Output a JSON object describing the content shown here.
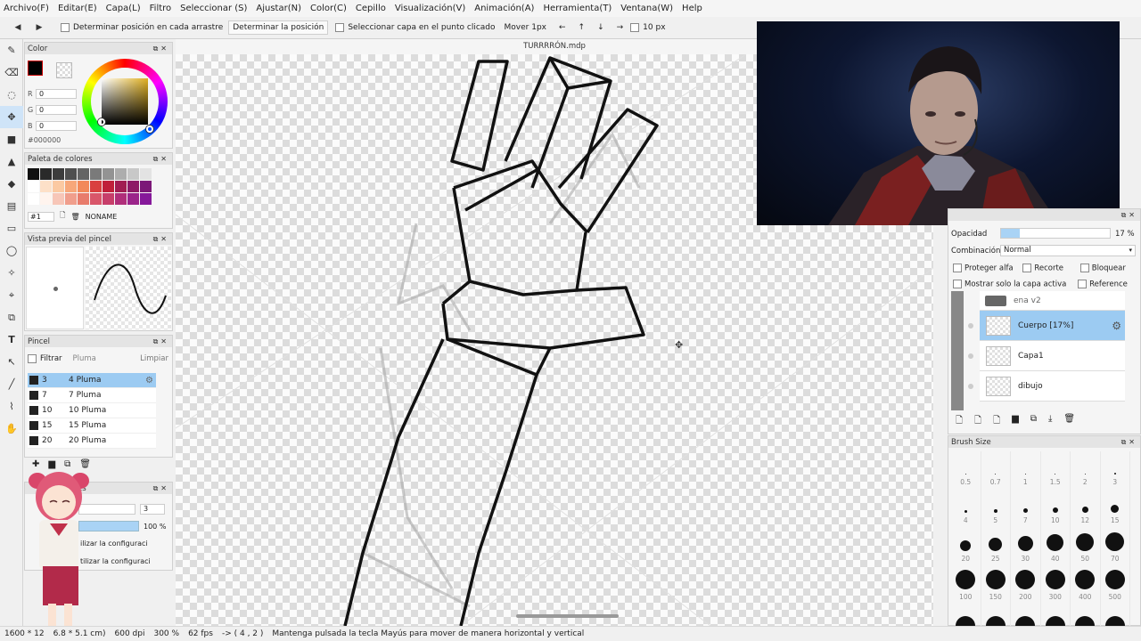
{
  "menu": [
    "Archivo(F)",
    "Editar(E)",
    "Capa(L)",
    "Filtro",
    "Seleccionar (S)",
    "Ajustar(N)",
    "Color(C)",
    "Cepillo",
    "Visualización(V)",
    "Animación(A)",
    "Herramienta(T)",
    "Ventana(W)",
    "Help"
  ],
  "toolbar": {
    "check1": "Determinar posición en cada arrastre",
    "button1": "Determinar la posición",
    "check2": "Seleccionar capa en el punto clicado",
    "move_label": "Mover 1px",
    "px_value": "10 px"
  },
  "color_panel": {
    "title": "Color",
    "r_label": "R",
    "r_value": "0",
    "g_label": "G",
    "g_value": "0",
    "b_label": "B",
    "b_value": "0",
    "hex": "#000000"
  },
  "palette_panel": {
    "title": "Paleta de colores",
    "index": "#1",
    "name": "NONAME",
    "colors": [
      "#111111",
      "#2a2a2a",
      "#3c3c3c",
      "#4f4f4f",
      "#646464",
      "#7a7a7a",
      "#939393",
      "#adadad",
      "#c8c8c8",
      "#e3e3e3",
      "#ffffff",
      "#fde0c8",
      "#fbc9a2",
      "#f7a77a",
      "#f2895a",
      "#d94040",
      "#c0203a",
      "#a11d52",
      "#8e1a66",
      "#7c1878",
      "#ffffff",
      "#fff4ee",
      "#f7c6b8",
      "#f09e8c",
      "#e87c6c",
      "#d9566a",
      "#c73e6a",
      "#b02e7a",
      "#9b248a",
      "#86199a"
    ]
  },
  "preview_panel": {
    "title": "Vista previa del pincel",
    "dot_label": "•"
  },
  "brush_panel": {
    "title": "Pincel",
    "filter_label": "Filtrar",
    "filter_placeholder": "Pluma",
    "clear_label": "Limpiar",
    "items": [
      {
        "num": "3",
        "name": "4 Pluma",
        "active": true
      },
      {
        "num": "7",
        "name": "7 Pluma",
        "active": false
      },
      {
        "num": "10",
        "name": "10 Pluma",
        "active": false
      },
      {
        "num": "15",
        "name": "15 Pluma",
        "active": false
      },
      {
        "num": "20",
        "name": "20 Pluma",
        "active": false
      }
    ]
  },
  "props_panel": {
    "title": "es",
    "size_value": "3",
    "opacity_value": "100 %",
    "dropdown1": "ilizar la configuraci",
    "dropdown2": "tilizar la configuraci"
  },
  "canvas": {
    "title": "TURRRRÓN.mdp"
  },
  "layer_panel": {
    "opacity_label": "Opacidad",
    "opacity_value": "17 %",
    "opacity_fraction": 0.17,
    "blend_label": "Combinación",
    "blend_value": "Normal",
    "protect_alpha": "Proteger alfa",
    "clip": "Recorte",
    "lock": "Bloquear",
    "show_active": "Mostrar solo la capa activa",
    "reference": "Reference",
    "folder": "ena v2",
    "layers": [
      {
        "name": "Cuerpo [17%]",
        "active": true
      },
      {
        "name": "Capa1",
        "active": false
      },
      {
        "name": "dibujo",
        "active": false
      }
    ]
  },
  "brush_size_panel": {
    "title": "Brush Size",
    "sizes": [
      "0.5",
      "0.7",
      "1",
      "1.5",
      "2",
      "3",
      "4",
      "5",
      "7",
      "10",
      "12",
      "15",
      "20",
      "25",
      "30",
      "40",
      "50",
      "70",
      "100",
      "150",
      "200",
      "300",
      "400",
      "500",
      "",
      "",
      "",
      "",
      "",
      ""
    ]
  },
  "status": {
    "dims": "1600 * 12",
    "cm": "6.8 * 5.1 cm)",
    "dpi": "600 dpi",
    "zoom": "300 %",
    "fps": "62 fps",
    "coords": "-> ( 4 , 2 )",
    "hint": "Mantenga pulsada la tecla Mayús para mover de manera horizontal y vertical"
  },
  "colors": {
    "accent": "#9ccbf2",
    "panel_header": "#e4e4e4",
    "canvas_bg": "#e8e8e8"
  }
}
